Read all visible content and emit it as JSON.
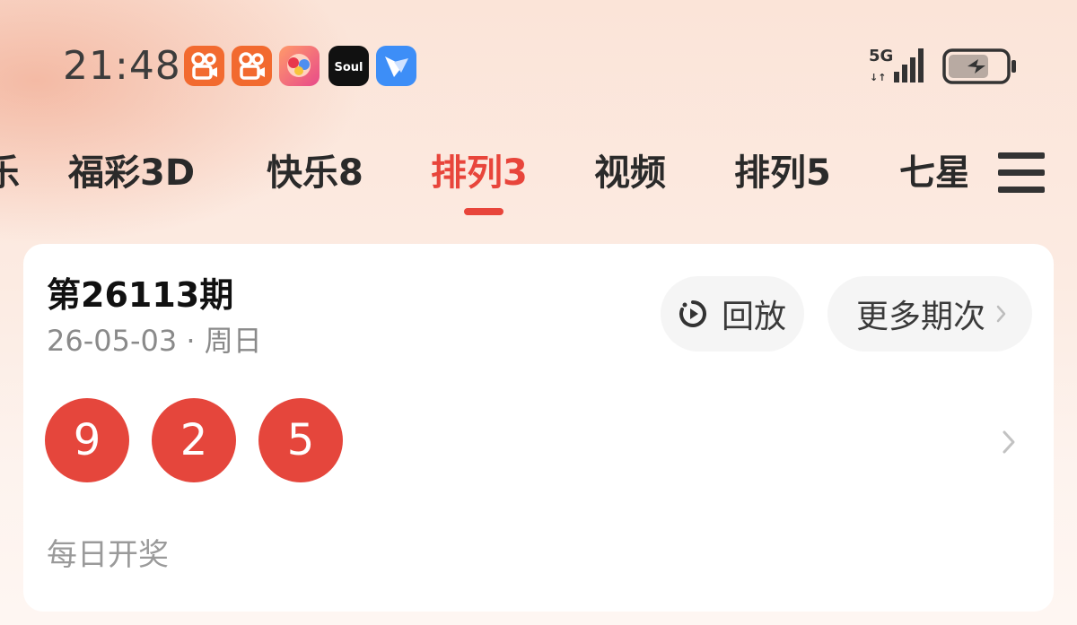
{
  "status_bar": {
    "time": "21:48",
    "apps": [
      {
        "name": "kuaishou-icon",
        "color": "#f26a2f"
      },
      {
        "name": "kuaishou-icon",
        "color": "#f26a2f"
      },
      {
        "name": "game-app-icon",
        "color": "#f06080"
      },
      {
        "name": "soul-icon",
        "label": "Soul",
        "color": "#111111"
      },
      {
        "name": "feishu-icon",
        "color": "#3d8ef7"
      }
    ],
    "network": "5G",
    "battery_state": "charging"
  },
  "tabs": [
    {
      "label": "大乐透",
      "active": false
    },
    {
      "label": "福彩3D",
      "active": false
    },
    {
      "label": "快乐8",
      "active": false
    },
    {
      "label": "排列3",
      "active": true
    },
    {
      "label": "视频",
      "active": false
    },
    {
      "label": "排列5",
      "active": false
    },
    {
      "label": "七星彩",
      "active": false
    }
  ],
  "card": {
    "title": "第26113期",
    "date": "26-05-03 · 周日",
    "replay_label": "回放",
    "more_label": "更多期次",
    "numbers": [
      "9",
      "2",
      "5"
    ],
    "footer": "每日开奖"
  },
  "colors": {
    "accent": "#e8453b",
    "ball": "#e5463c"
  }
}
